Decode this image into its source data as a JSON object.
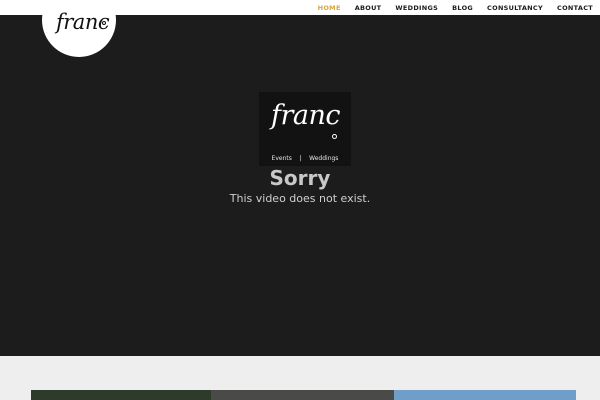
{
  "brand": {
    "logo_text": "franc",
    "video_logo_text": "franc",
    "video_logo_tagline": "Events    |    Weddings"
  },
  "nav": {
    "items": [
      {
        "label": "HOME",
        "active": true
      },
      {
        "label": "ABOUT",
        "active": false
      },
      {
        "label": "WEDDINGS",
        "active": false
      },
      {
        "label": "BLOG",
        "active": false
      },
      {
        "label": "CONSULTANCY",
        "active": false
      },
      {
        "label": "CONTACT",
        "active": false
      }
    ],
    "active_color": "#d9a441"
  },
  "video": {
    "error_title": "Sorry",
    "error_message": "This video does not exist."
  },
  "colors": {
    "hero_background": "#1c1c1c",
    "page_background": "#eeeeee"
  }
}
